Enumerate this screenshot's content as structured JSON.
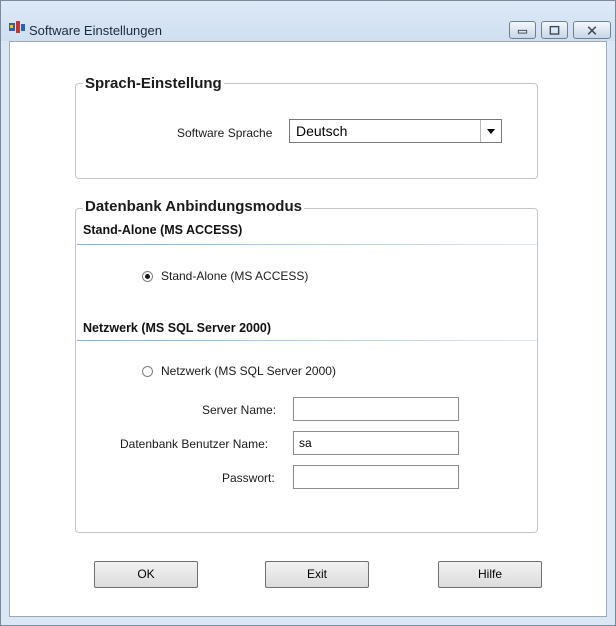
{
  "window": {
    "title": "Software Einstellungen"
  },
  "language_group": {
    "legend": "Sprach-Einstellung",
    "label": "Software Sprache",
    "selected": "Deutsch"
  },
  "db_group": {
    "legend": "Datenbank Anbindungsmodus",
    "standalone": {
      "header": "Stand-Alone (MS ACCESS)",
      "radio_label": "Stand-Alone (MS ACCESS)",
      "checked": true
    },
    "network": {
      "header": "Netzwerk (MS SQL Server 2000)",
      "radio_label": "Netzwerk (MS SQL Server 2000)",
      "checked": false
    },
    "fields": {
      "server_label": "Server Name:",
      "server_value": "",
      "user_label": "Datenbank Benutzer Name:",
      "user_value": "sa",
      "password_label": "Passwort:",
      "password_value": ""
    }
  },
  "buttons": {
    "ok": "OK",
    "exit": "Exit",
    "help": "Hilfe"
  }
}
